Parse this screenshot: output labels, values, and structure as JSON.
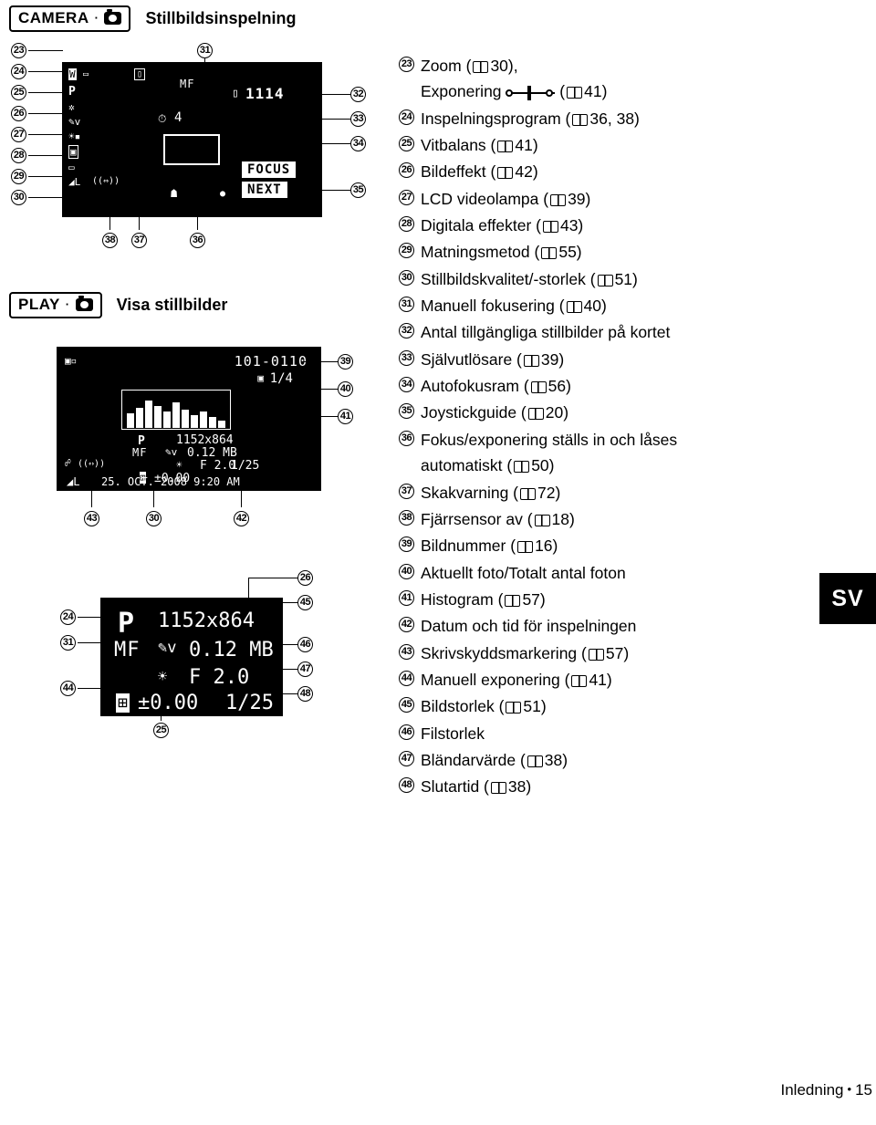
{
  "page": {
    "footer_text": "Inledning",
    "footer_bullet": "•",
    "page_number": "15",
    "language_tab": "SV"
  },
  "sections": [
    {
      "badge": "CAMERA",
      "badge_dot": "·",
      "title": "Stillbildsinspelning"
    },
    {
      "badge": "PLAY",
      "badge_dot": "·",
      "title": "Visa stillbilder"
    }
  ],
  "lcd_camera": {
    "labels": [
      "W",
      "D",
      "P",
      "MF",
      "1114",
      "4",
      "FOCUS",
      "NEXT",
      "L"
    ],
    "counter": "1114",
    "selftimer": "4",
    "focus_label": "FOCUS",
    "next_label": "NEXT"
  },
  "lcd_play1": {
    "file_number": "101-0110",
    "frame_counter": "1/4",
    "program": "P",
    "size": "1152x864",
    "manual_focus": "MF",
    "filesize": "0.12 MB",
    "aperture": "F 2.0",
    "shutter": "1/25",
    "exposure": "±0.00",
    "datetime": "25. OCT. 2008   9:20 AM",
    "quality": "L"
  },
  "lcd_play2": {
    "program": "P",
    "size": "1152x864",
    "manual_focus": "MF",
    "filesize": "0.12 MB",
    "aperture": "F 2.0",
    "shutter": "1/25",
    "exposure": "±0.00"
  },
  "callout_numbers": {
    "left_camera_column": [
      "23",
      "24",
      "25",
      "26",
      "27",
      "28",
      "29",
      "30"
    ],
    "camera_bottom": [
      "38",
      "37",
      "36"
    ],
    "camera_right": [
      "32",
      "33",
      "34",
      "35"
    ],
    "play1_right": [
      "39",
      "40",
      "41"
    ],
    "play1_bottom": [
      "43",
      "30",
      "42"
    ],
    "play2_left": [
      "24",
      "31",
      "44"
    ],
    "play2_right": [
      "26",
      "45",
      "46",
      "47",
      "48"
    ],
    "play2_bottom": [
      "25"
    ]
  },
  "legend": [
    {
      "num": "23",
      "text": "Zoom (",
      "book": true,
      "page": "30),",
      "second_line": "Exponering",
      "second_book": true,
      "second_page": "41)",
      "has_exposure_icon": true
    },
    {
      "num": "24",
      "text": "Inspelningsprogram (",
      "book": true,
      "page": "36, 38)"
    },
    {
      "num": "25",
      "text": "Vitbalans (",
      "book": true,
      "page": "41)"
    },
    {
      "num": "26",
      "text": "Bildeffekt (",
      "book": true,
      "page": "42)"
    },
    {
      "num": "27",
      "text": "LCD videolampa (",
      "book": true,
      "page": "39)"
    },
    {
      "num": "28",
      "text": "Digitala effekter (",
      "book": true,
      "page": "43)"
    },
    {
      "num": "29",
      "text": "Matningsmetod (",
      "book": true,
      "page": "55)"
    },
    {
      "num": "30",
      "text": "Stillbildskvalitet/-storlek (",
      "book": true,
      "page": "51)"
    },
    {
      "num": "31",
      "text": "Manuell fokusering (",
      "book": true,
      "page": "40)"
    },
    {
      "num": "32",
      "text": "Antal tillgängliga stillbilder på kortet",
      "book": false,
      "page": ""
    },
    {
      "num": "33",
      "text": "Självutlösare (",
      "book": true,
      "page": "39)"
    },
    {
      "num": "34",
      "text": "Autofokusram (",
      "book": true,
      "page": "56)"
    },
    {
      "num": "35",
      "text": "Joystickguide (",
      "book": true,
      "page": "20)"
    },
    {
      "num": "36",
      "text": "Fokus/exponering ställs in och låses",
      "book": false,
      "page": "",
      "cont": "automatiskt (",
      "cont_book": true,
      "cont_page": "50)"
    },
    {
      "num": "37",
      "text": "Skakvarning (",
      "book": true,
      "page": "72)"
    },
    {
      "num": "38",
      "text": "Fjärrsensor av (",
      "book": true,
      "page": "18)"
    },
    {
      "num": "39",
      "text": "Bildnummer (",
      "book": true,
      "page": "16)"
    },
    {
      "num": "40",
      "text": "Aktuellt foto/Totalt antal foton",
      "book": false,
      "page": ""
    },
    {
      "num": "41",
      "text": "Histogram (",
      "book": true,
      "page": "57)"
    },
    {
      "num": "42",
      "text": "Datum och tid för inspelningen",
      "book": false,
      "page": ""
    },
    {
      "num": "43",
      "text": "Skrivskyddsmarkering (",
      "book": true,
      "page": "57)"
    },
    {
      "num": "44",
      "text": "Manuell exponering (",
      "book": true,
      "page": "41)"
    },
    {
      "num": "45",
      "text": "Bildstorlek (",
      "book": true,
      "page": "51)"
    },
    {
      "num": "46",
      "text": "Filstorlek",
      "book": false,
      "page": ""
    },
    {
      "num": "47",
      "text": "Bländarvärde (",
      "book": true,
      "page": "38)"
    },
    {
      "num": "48",
      "text": "Slutartid (",
      "book": true,
      "page": "38)"
    }
  ]
}
